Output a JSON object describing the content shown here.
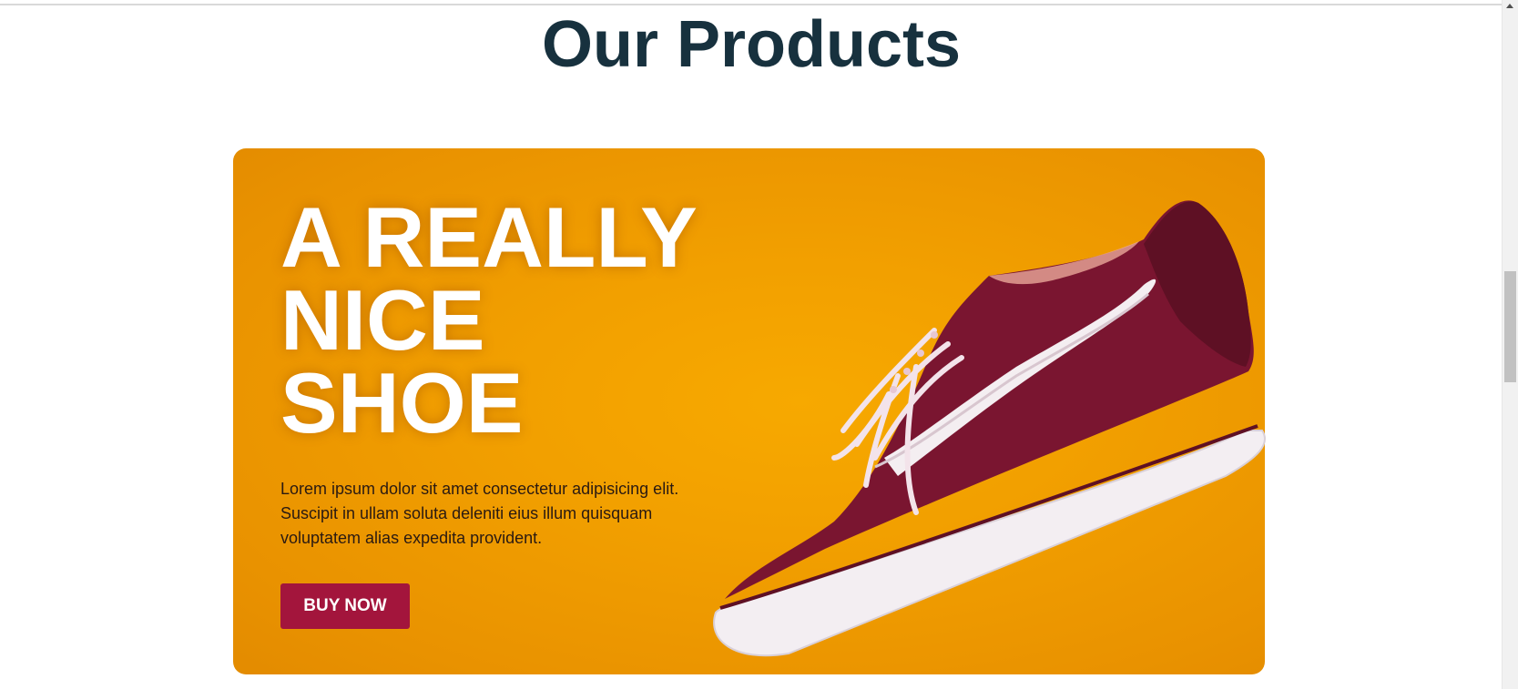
{
  "section": {
    "title": "Our Products"
  },
  "hero": {
    "title_lines": [
      "A REALLY",
      "NICE",
      "SHOE"
    ],
    "description": "Lorem ipsum dolor sit amet consectetur adipisicing elit. Suscipit in ullam soluta deleniti eius illum quisquam voluptatem alias expedita provident.",
    "button_label": "BUY NOW"
  },
  "colors": {
    "heading": "#17313e",
    "card_background": "#f2a000",
    "button_background": "#a3153c",
    "shoe_suede": "#7a1530",
    "shoe_sole": "#f3eef2"
  },
  "icons": {
    "shoe_image": "sneaker-image",
    "scroll_up": "arrow-up-icon"
  }
}
